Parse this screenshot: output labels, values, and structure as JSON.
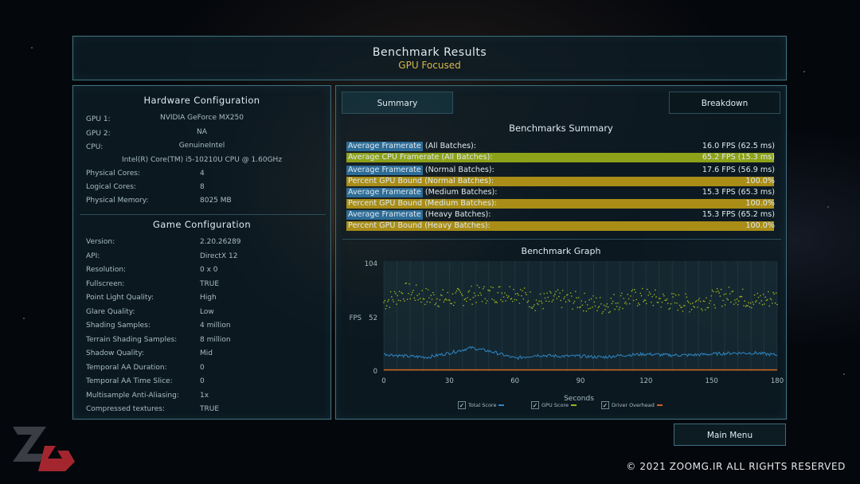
{
  "header": {
    "title": "Benchmark Results",
    "subtitle": "GPU Focused"
  },
  "hardware": {
    "title": "Hardware Configuration",
    "gpu1_label": "GPU 1:",
    "gpu1_value": "NVIDIA GeForce MX250",
    "gpu2_label": "GPU 2:",
    "gpu2_value": "NA",
    "cpu_label": "CPU:",
    "cpu_vendor": "GenuineIntel",
    "cpu_model": "Intel(R) Core(TM) i5-10210U CPU @ 1.60GHz",
    "phys_cores_label": "Physical Cores:",
    "phys_cores_value": "4",
    "log_cores_label": "Logical Cores:",
    "log_cores_value": "8",
    "memory_label": "Physical Memory:",
    "memory_value": "8025  MB"
  },
  "game": {
    "title": "Game Configuration",
    "rows": [
      {
        "k": "Version:",
        "v": "2.20.26289"
      },
      {
        "k": "API:",
        "v": "DirectX 12"
      },
      {
        "k": "Resolution:",
        "v": "0 x 0"
      },
      {
        "k": "Fullscreen:",
        "v": "TRUE"
      },
      {
        "k": "Point Light Quality:",
        "v": "High"
      },
      {
        "k": "Glare Quality:",
        "v": "Low"
      },
      {
        "k": "Shading Samples:",
        "v": "4 million"
      },
      {
        "k": "Terrain Shading Samples:",
        "v": "8 million"
      },
      {
        "k": "Shadow Quality:",
        "v": "Mid"
      },
      {
        "k": "Temporal AA Duration:",
        "v": "0"
      },
      {
        "k": "Temporal AA Time Slice:",
        "v": "0"
      },
      {
        "k": "Multisample Anti-Aliasing:",
        "v": "1x"
      },
      {
        "k": "Compressed textures:",
        "v": "TRUE"
      }
    ]
  },
  "tabs": {
    "summary": "Summary",
    "breakdown": "Breakdown"
  },
  "summary": {
    "title": "Benchmarks Summary",
    "rows": [
      {
        "hl": "Average Framerate",
        "rest": " (All Batches):",
        "value": "16.0 FPS (62.5 ms)",
        "style": "blue",
        "fill": 0
      },
      {
        "hl": "Average CPU Framerate (All Batches):",
        "rest": "",
        "value": "65.2 FPS (15.3 ms)",
        "style": "green",
        "fill": 0.995
      },
      {
        "hl": "Average Framerate",
        "rest": " (Normal Batches):",
        "value": "17.6 FPS (56.9 ms)",
        "style": "blue",
        "fill": 0
      },
      {
        "hl": "Percent GPU Bound (Normal Batches):",
        "rest": "",
        "value": "100.0%",
        "style": "yellow",
        "fill": 0.995
      },
      {
        "hl": "Average Framerate",
        "rest": " (Medium Batches):",
        "value": "15.3 FPS (65.3 ms)",
        "style": "blue",
        "fill": 0
      },
      {
        "hl": "Percent GPU Bound (Medium Batches):",
        "rest": "",
        "value": "100.0%",
        "style": "yellow",
        "fill": 0.995
      },
      {
        "hl": "Average Framerate",
        "rest": " (Heavy Batches):",
        "value": "15.3 FPS (65.2 ms)",
        "style": "blue",
        "fill": 0
      },
      {
        "hl": "Percent GPU Bound (Heavy Batches):",
        "rest": "",
        "value": "100.0%",
        "style": "yellow",
        "fill": 0.995
      }
    ]
  },
  "graph": {
    "title": "Benchmark Graph",
    "ylabel": "FPS",
    "xlabel": "Seconds",
    "yticks": [
      "104",
      "52",
      "0"
    ],
    "xticks": [
      "0",
      "30",
      "60",
      "90",
      "120",
      "150",
      "180"
    ],
    "legend": {
      "total": "Total Score",
      "gpu": "GPU Score",
      "driver": "Driver Overhead"
    }
  },
  "colors": {
    "total": "#2f86c4",
    "gpu": "#9fb21c",
    "driver": "#d0641e",
    "panel_border": "#3f6f7c",
    "accent_gold": "#d9b74a"
  },
  "main_menu": "Main Menu",
  "copyright": "© 2021 ZOOMG.IR ALL RIGHTS RESERVED",
  "chart_data": {
    "type": "scatter",
    "title": "Benchmark Graph",
    "xlabel": "Seconds",
    "ylabel": "FPS",
    "xlim": [
      0,
      180
    ],
    "ylim": [
      0,
      104
    ],
    "series": [
      {
        "name": "Total Score",
        "x": [
          0,
          10,
          20,
          30,
          40,
          50,
          60,
          70,
          80,
          90,
          100,
          110,
          120,
          130,
          140,
          150,
          160,
          170,
          180
        ],
        "y": [
          16,
          14,
          13,
          17,
          22,
          18,
          12,
          15,
          14,
          14,
          13,
          15,
          16,
          15,
          15,
          16,
          17,
          17,
          15
        ]
      },
      {
        "name": "GPU Score",
        "x": [
          0,
          10,
          20,
          30,
          40,
          50,
          60,
          70,
          80,
          90,
          100,
          110,
          120,
          130,
          140,
          150,
          160,
          170,
          180
        ],
        "y": [
          65,
          75,
          70,
          68,
          72,
          73,
          75,
          65,
          68,
          66,
          62,
          68,
          70,
          66,
          64,
          68,
          72,
          66,
          70
        ]
      },
      {
        "name": "Driver Overhead",
        "x": [
          0,
          30,
          60,
          90,
          120,
          150,
          180
        ],
        "y": [
          1,
          1,
          1,
          1,
          1,
          1,
          1
        ]
      }
    ]
  }
}
